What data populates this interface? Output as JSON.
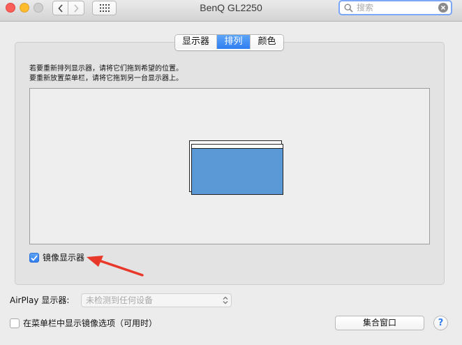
{
  "window": {
    "title": "BenQ GL2250"
  },
  "toolbar": {
    "search_placeholder": "搜索"
  },
  "tabs": [
    {
      "label": "显示器",
      "active": false
    },
    {
      "label": "排列",
      "active": true
    },
    {
      "label": "颜色",
      "active": false
    }
  ],
  "arrangement": {
    "instruction_line1": "若要重新排列显示器，请将它们拖到希望的位置。",
    "instruction_line2": "要重新放置菜单栏，请将它拖到另一台显示器上。",
    "display_color": "#5b99d6"
  },
  "mirror": {
    "label": "镜像显示器",
    "checked": true
  },
  "airplay": {
    "label": "AirPlay 显示器:",
    "selected_value": "未检测到任何设备"
  },
  "menubar_option": {
    "label": "在菜单栏中显示镜像选项（可用时）",
    "checked": false
  },
  "buttons": {
    "gather_windows": "集合窗口",
    "help": "?"
  },
  "colors": {
    "accent": "#2e7ef2",
    "annotation_arrow": "#e8382a"
  }
}
